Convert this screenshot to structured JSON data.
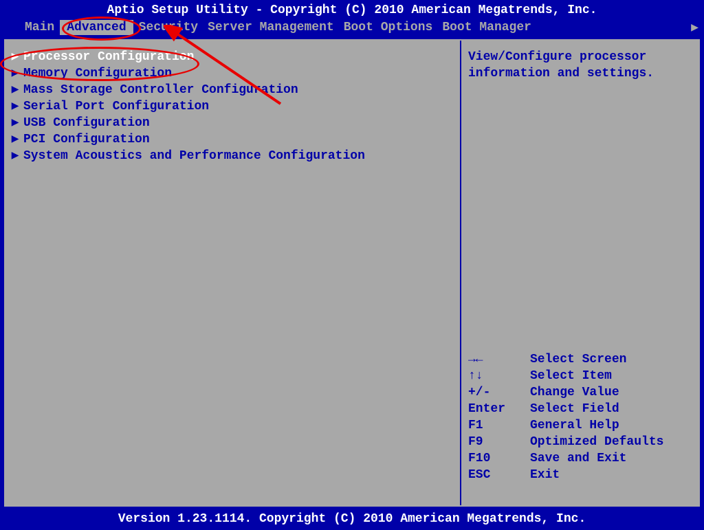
{
  "header": {
    "title": "Aptio Setup Utility - Copyright (C) 2010 American Megatrends, Inc."
  },
  "tabs": {
    "items": [
      {
        "label": "Main"
      },
      {
        "label": "Advanced"
      },
      {
        "label": "Security"
      },
      {
        "label": "Server Management"
      },
      {
        "label": "Boot Options"
      },
      {
        "label": "Boot Manager"
      }
    ],
    "active_index": 1
  },
  "menu": {
    "items": [
      {
        "label": "Processor Configuration"
      },
      {
        "label": "Memory Configuration"
      },
      {
        "label": "Mass Storage Controller Configuration"
      },
      {
        "label": "Serial Port Configuration"
      },
      {
        "label": "USB Configuration"
      },
      {
        "label": "PCI Configuration"
      },
      {
        "label": "System Acoustics and Performance Configuration"
      }
    ],
    "selected_index": 0
  },
  "help": {
    "text_line1": "View/Configure processor",
    "text_line2": "information and settings."
  },
  "key_help": {
    "rows": [
      {
        "key": "→←",
        "action": "Select Screen"
      },
      {
        "key": "↑↓",
        "action": "Select Item"
      },
      {
        "key": "+/-",
        "action": "Change Value"
      },
      {
        "key": "Enter",
        "action": "Select Field"
      },
      {
        "key": "F1",
        "action": "General Help"
      },
      {
        "key": "F9",
        "action": "Optimized Defaults"
      },
      {
        "key": "F10",
        "action": "Save and Exit"
      },
      {
        "key": "ESC",
        "action": "Exit"
      }
    ]
  },
  "footer": {
    "text": "Version 1.23.1114. Copyright (C) 2010 American Megatrends, Inc."
  }
}
